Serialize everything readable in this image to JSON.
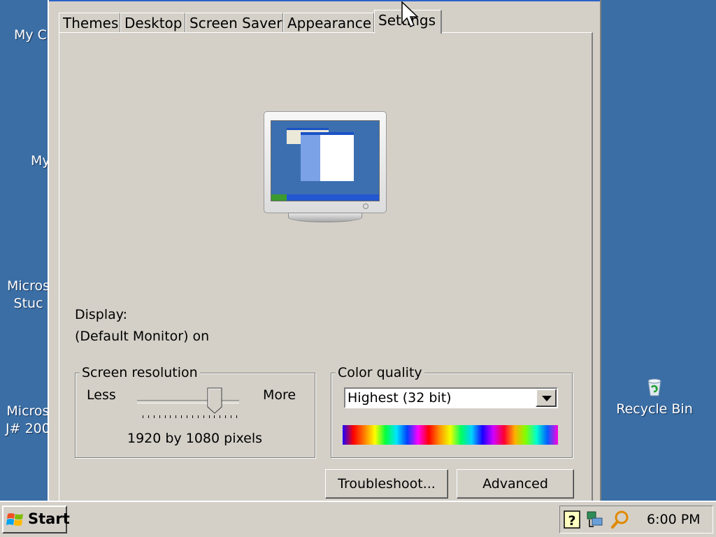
{
  "desktop": {
    "icons": [
      {
        "label": "My C",
        "id": "my-computer"
      },
      {
        "label": "My",
        "id": "my-documents"
      },
      {
        "label": "Micros\nStuc",
        "id": "microsoft-studio"
      },
      {
        "label": "Micros\nJ# 200",
        "id": "microsoft-jsharp"
      }
    ],
    "recycle_bin": "Recycle Bin"
  },
  "dialog": {
    "tabs": [
      "Themes",
      "Desktop",
      "Screen Saver",
      "Appearance",
      "Settings"
    ],
    "active_tab": "Settings",
    "display_label": "Display:",
    "display_value": "(Default Monitor) on",
    "resolution": {
      "legend": "Screen resolution",
      "less": "Less",
      "more": "More",
      "value_text": "1920 by 1080 pixels",
      "slider_position": 0.76
    },
    "color_quality": {
      "legend": "Color quality",
      "selected": "Highest (32 bit)"
    },
    "buttons": {
      "troubleshoot": "Troubleshoot...",
      "advanced": "Advanced"
    }
  },
  "taskbar": {
    "start_label": "Start",
    "clock": "6:00 PM",
    "tray_icons": [
      "help-icon",
      "network-icon",
      "search-icon"
    ]
  }
}
